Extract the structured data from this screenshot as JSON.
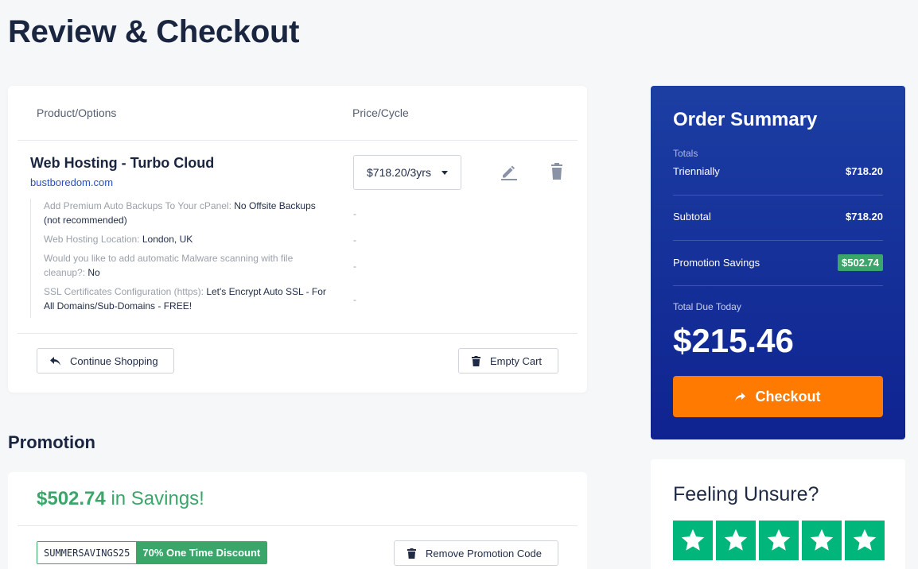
{
  "page": {
    "title": "Review & Checkout"
  },
  "cart": {
    "headers": {
      "product": "Product/Options",
      "price": "Price/Cycle"
    },
    "item": {
      "name": "Web Hosting - Turbo Cloud",
      "domain": "bustboredom.com",
      "cycle_selected": "$718.20/3yrs",
      "options": [
        {
          "label": "Add Premium Auto Backups To Your cPanel:",
          "value": "No Offsite Backups (not recommended)",
          "price": "-"
        },
        {
          "label": "Web Hosting Location:",
          "value": "London, UK",
          "price": "-"
        },
        {
          "label": "Would you like to add automatic Malware scanning with file cleanup?:",
          "value": "No",
          "price": "-"
        },
        {
          "label": "SSL Certificates Configuration (https):",
          "value": "Let's Encrypt Auto SSL - For All Domains/Sub-Domains - FREE!",
          "price": "-"
        }
      ]
    },
    "continue_label": "Continue Shopping",
    "empty_label": "Empty Cart"
  },
  "promotion": {
    "title": "Promotion",
    "savings_amount": "$502.74",
    "savings_text": "in Savings!",
    "code": "SUMMERSAVINGS25",
    "description": "70% One Time Discount",
    "remove_label": "Remove Promotion Code"
  },
  "summary": {
    "title": "Order Summary",
    "totals_label": "Totals",
    "cycle_label": "Triennially",
    "cycle_amount": "$718.20",
    "subtotal_label": "Subtotal",
    "subtotal_amount": "$718.20",
    "savings_label": "Promotion Savings",
    "savings_amount": "$502.74",
    "due_label": "Total Due Today",
    "due_amount": "$215.46",
    "checkout_label": "Checkout"
  },
  "unsure": {
    "title": "Feeling Unsure?",
    "stars": 5
  },
  "colors": {
    "accent_green": "#3aa66a",
    "summary_blue": "#1c3ea3",
    "checkout_orange": "#ff7a00",
    "trustpilot_green": "#00b67a"
  },
  "icons": [
    "edit-icon",
    "trash-icon",
    "reply-icon",
    "share-icon",
    "star-icon"
  ]
}
